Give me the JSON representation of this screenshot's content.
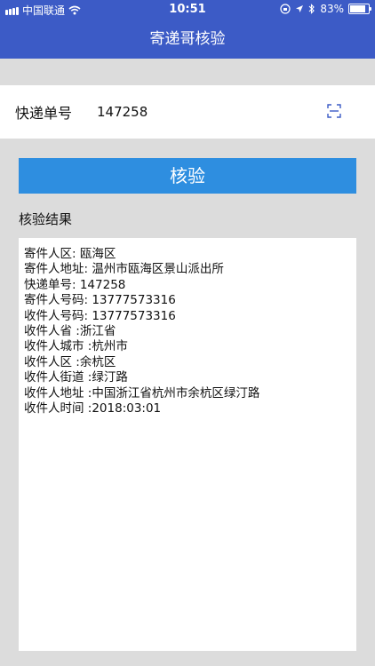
{
  "status_bar": {
    "carrier": "中国联通",
    "time": "10:51",
    "battery": "83%",
    "battery_level": 0.83,
    "icons": [
      "signal-icon",
      "wifi-icon",
      "orientation-lock-icon",
      "location-icon",
      "bluetooth-icon",
      "battery-icon"
    ]
  },
  "nav": {
    "title": "寄递哥核验"
  },
  "input": {
    "label": "快递单号",
    "value": "147258",
    "scan_icon": "scan-icon"
  },
  "verify_button": {
    "label": "核验"
  },
  "result": {
    "title": "核验结果",
    "lines": [
      "寄件人区: 瓯海区",
      "寄件人地址: 温州市瓯海区景山派出所",
      "快递单号: 147258",
      "寄件人号码: 13777573316",
      "收件人号码: 13777573316",
      "收件人省 :浙江省",
      "收件人城市 :杭州市",
      "收件人区 :余杭区",
      "收件人街道 :绿汀路",
      "收件人地址 :中国浙江省杭州市余杭区绿汀路",
      "收件人时间 :2018:03:01"
    ]
  },
  "colors": {
    "header": "#3c5bc6",
    "button": "#2e8ee0",
    "background": "#dcdcdc"
  }
}
